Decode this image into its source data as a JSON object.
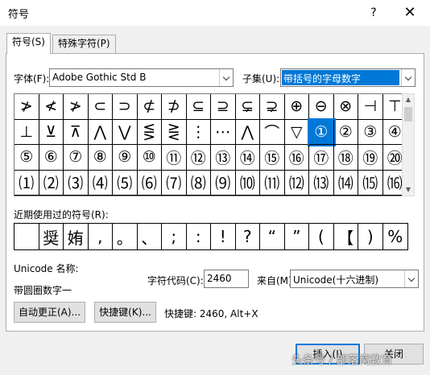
{
  "window": {
    "title": "符号",
    "help_label": "?",
    "close_label": "✕"
  },
  "tabs": [
    {
      "label": "符号(S)",
      "active": true
    },
    {
      "label": "特殊字符(P)",
      "active": false
    }
  ],
  "font": {
    "label": "字体(F):",
    "value": "Adobe Gothic Std B"
  },
  "subset": {
    "label": "子集(U):",
    "value": "带括号的字母数字"
  },
  "symbol_grid": [
    [
      "≯",
      "≮",
      "≯",
      "⊂",
      "⊃",
      "⊄",
      "⊅",
      "⊆",
      "⊇",
      "⊊",
      "⊋",
      "⊕",
      "⊖",
      "⊗",
      "⊣",
      "⊤"
    ],
    [
      "⊥",
      "⊻",
      "⊼",
      "⋀",
      "⋁",
      "⋚",
      "⋛",
      "⋮",
      "⋯",
      "⋀",
      "⌒",
      "▽",
      "①",
      "②",
      "③",
      "④"
    ],
    [
      "⑤",
      "⑥",
      "⑦",
      "⑧",
      "⑨",
      "⑩",
      "⑪",
      "⑫",
      "⑬",
      "⑭",
      "⑮",
      "⑯",
      "⑰",
      "⑱",
      "⑲",
      "⑳"
    ],
    [
      "⑴",
      "⑵",
      "⑶",
      "⑷",
      "⑸",
      "⑹",
      "⑺",
      "⑻",
      "⑼",
      "⑽",
      "⑾",
      "⑿",
      "⒀",
      "⒁",
      "⒂",
      "⒃"
    ]
  ],
  "selected_symbol": "①",
  "recent": {
    "label": "近期使用过的符号(R):",
    "symbols": [
      "",
      "奨",
      "姷",
      ",",
      "。",
      "、",
      ";",
      ":",
      "!",
      "?",
      "“",
      "”",
      "(",
      "【",
      ")",
      "%"
    ]
  },
  "unicode_name": {
    "label": "Unicode 名称:",
    "value": "带圆圈数字一"
  },
  "char_code": {
    "label": "字符代码(C):",
    "value": "2460"
  },
  "from": {
    "label": "来自(M):",
    "value": "Unicode(十六进制)"
  },
  "buttons": {
    "autocorrect": "自动更正(A)...",
    "shortcut_key": "快捷键(K)...",
    "shortcut_info": "快捷键: 2460, Alt+X",
    "insert": "插入(I)",
    "close": "关闭"
  },
  "watermark": "头条号 / 部落窝教育"
}
